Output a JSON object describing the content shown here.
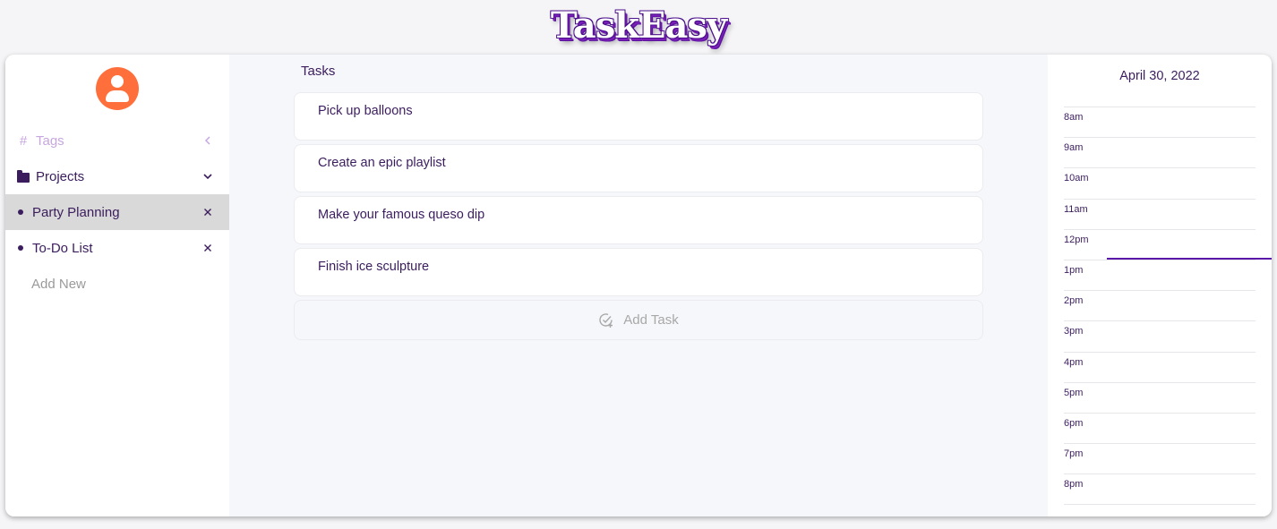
{
  "brand": {
    "logo_text": "TaskEasy"
  },
  "sidebar": {
    "tags_label": "Tags",
    "projects_label": "Projects",
    "projects": [
      {
        "label": "Party Planning",
        "active": true
      },
      {
        "label": "To-Do List",
        "active": false
      }
    ],
    "add_new_label": "Add New"
  },
  "main": {
    "title": "Tasks",
    "tasks": [
      {
        "text": "Pick up balloons"
      },
      {
        "text": "Create an epic playlist"
      },
      {
        "text": "Make your famous queso dip"
      },
      {
        "text": "Finish ice sculpture"
      }
    ],
    "add_task_label": "Add Task"
  },
  "calendar": {
    "date": "April 30, 2022",
    "hours": [
      "8am",
      "9am",
      "10am",
      "11am",
      "12pm",
      "1pm",
      "2pm",
      "3pm",
      "4pm",
      "5pm",
      "6pm",
      "7pm",
      "8pm"
    ],
    "current_time_hour_index": 5
  },
  "colors": {
    "avatar": "#ff6f3c",
    "text": "#3b1d5e",
    "tags": "#c8a6e0",
    "active_row": "#d9d9d9",
    "now_line": "#5b17a8"
  }
}
